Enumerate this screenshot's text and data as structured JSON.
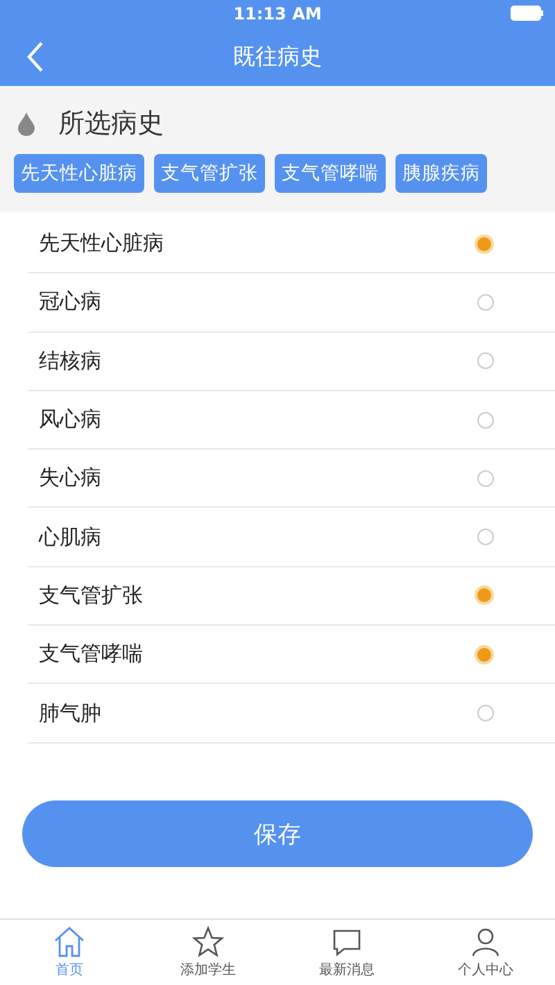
{
  "status_bar": {
    "time": "11:13 AM"
  },
  "nav_bar": {
    "title": "既往病史"
  },
  "selected_section": {
    "title": "所选病史",
    "tags": [
      "先天性心脏病",
      "支气管扩张",
      "支气管哮喘",
      "胰腺疾病"
    ]
  },
  "diseases": [
    {
      "label": "先天性心脏病",
      "selected": true
    },
    {
      "label": "冠心病",
      "selected": false
    },
    {
      "label": "结核病",
      "selected": false
    },
    {
      "label": "风心病",
      "selected": false
    },
    {
      "label": "失心病",
      "selected": false
    },
    {
      "label": "心肌病",
      "selected": false
    },
    {
      "label": "支气管扩张",
      "selected": true
    },
    {
      "label": "支气管哮喘",
      "selected": true
    },
    {
      "label": "肺气肿",
      "selected": false
    }
  ],
  "save_button": "保存",
  "tab_bar": [
    {
      "label": "首页",
      "kind": "home",
      "selected": true
    },
    {
      "label": "添加学生",
      "kind": "star",
      "selected": false
    },
    {
      "label": "最新消息",
      "kind": "message",
      "selected": false
    },
    {
      "label": "个人中心",
      "kind": "person",
      "selected": false
    }
  ]
}
